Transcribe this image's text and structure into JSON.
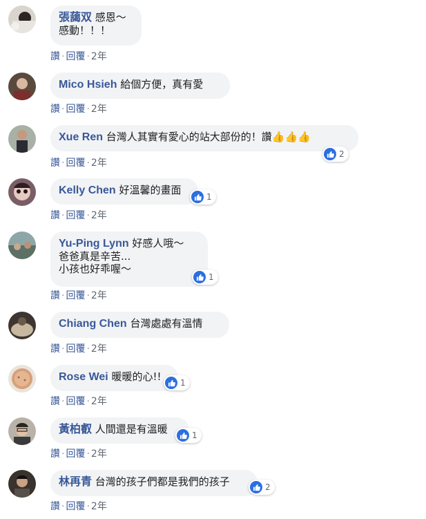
{
  "actions": {
    "like": "讚",
    "reply": "回覆",
    "time": "2年"
  },
  "comments": [
    {
      "author": "張藹双",
      "lines": [
        "感恩～",
        "感動！！！"
      ],
      "reactions": null
    },
    {
      "author": "Mico Hsieh",
      "lines": [
        "給個方便，真有愛"
      ],
      "reactions": null
    },
    {
      "author": "Xue Ren",
      "lines": [
        "台灣人其實有愛心的站大部份的！讚"
      ],
      "thumbs": "👍👍👍",
      "reactions": "2"
    },
    {
      "author": "Kelly Chen",
      "lines": [
        "好溫馨的畫面"
      ],
      "reactions": "1"
    },
    {
      "author": "Yu-Ping Lynn",
      "lines": [
        "好感人哦～",
        "爸爸真是辛苦...",
        "小孩也好乖喔～"
      ],
      "reactions": "1"
    },
    {
      "author": "Chiang Chen",
      "lines": [
        "台灣處處有溫情"
      ],
      "reactions": null
    },
    {
      "author": "Rose Wei",
      "lines": [
        "暖暖的心!!"
      ],
      "reactions": "1"
    },
    {
      "author": "黃柏叡",
      "lines": [
        "人間還是有溫暖"
      ],
      "reactions": "1"
    },
    {
      "author": "林再青",
      "lines": [
        "台灣的孩子們都是我們的孩子"
      ],
      "reactions": "2"
    }
  ],
  "colors": {
    "link": "#385898",
    "bubble": "#f2f3f5",
    "like": "#2b6fe0"
  }
}
